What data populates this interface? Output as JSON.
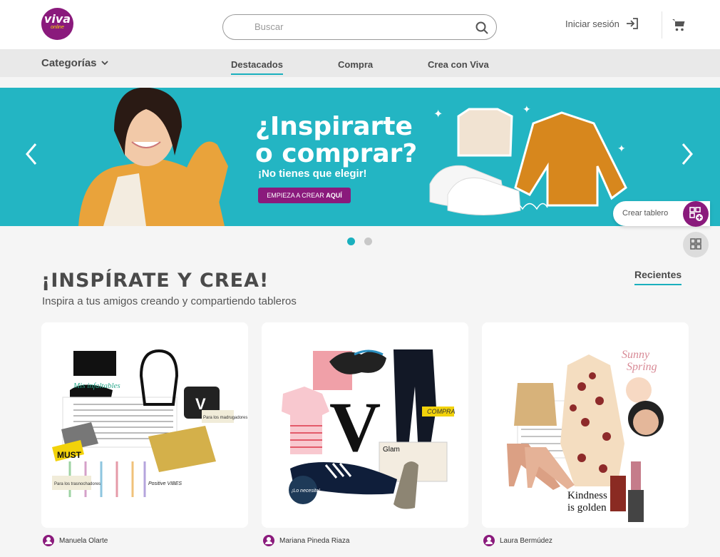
{
  "brand": {
    "line1": "viva",
    "line2": "online",
    "color": "#8a1a7c",
    "accent": "#1ab0be"
  },
  "search": {
    "placeholder": "Buscar"
  },
  "header": {
    "login_label": "Iniciar sesión",
    "login_icon": "login-arrow-icon",
    "cart_icon": "cart-icon"
  },
  "nav": {
    "categories_label": "Categorías",
    "tabs": [
      {
        "label": "Destacados",
        "active": true
      },
      {
        "label": "Compra"
      },
      {
        "label": "Crea con Viva"
      }
    ]
  },
  "banner": {
    "title_line1": "¿Inspirarte",
    "title_line2": "o comprar?",
    "subtitle": "¡No tienes que elegir!",
    "cta_label": "EMPIEZA A CREAR ",
    "cta_bold": "AQUÍ",
    "background": "#23b5c3"
  },
  "floating": {
    "create_board_label": "Crear tablero"
  },
  "carousel": {
    "slides": 2,
    "active": 1
  },
  "section": {
    "title": "¡INSPÍRATE Y CREA!",
    "subtitle": "Inspira a tus amigos creando y compartiendo tableros",
    "sort_label": "Recientes"
  },
  "boards": [
    {
      "author": "Manuela Olarte",
      "captions": [
        "Mis infaltables",
        "MUST",
        "Para los madrugadores",
        "Para los trasnochadores",
        "Positive VIBES"
      ]
    },
    {
      "author": "Mariana Pineda Riaza",
      "captions": [
        "V",
        "COMPRA",
        "Glam",
        "¡Lo necesito!"
      ]
    },
    {
      "author": "Laura Bermúdez",
      "captions": [
        "Sunny",
        "Spring",
        "Kindness",
        "is golden"
      ]
    }
  ]
}
